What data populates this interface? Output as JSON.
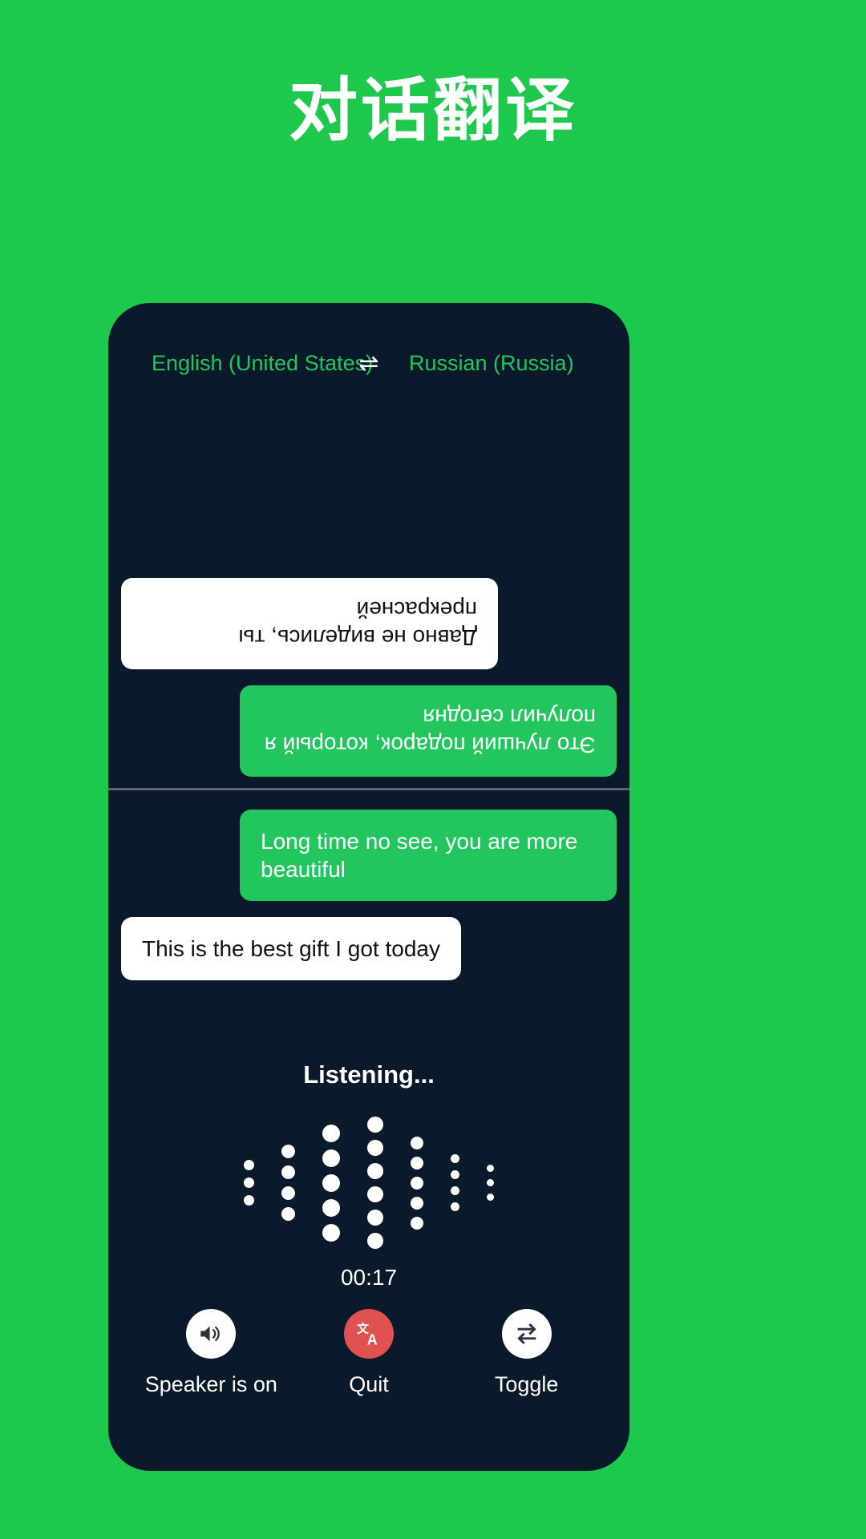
{
  "page": {
    "title": "对话翻译",
    "background_color": "#1DC84C"
  },
  "phone": {
    "background_color": "#0A1A2A",
    "accent_green": "#22C55E",
    "quit_red": "#E05252"
  },
  "language_bar": {
    "source_language": "English (United States)",
    "target_language": "Russian (Russia)",
    "swap_icon": "swap-horizontal-icon",
    "swap_glyph": "⇌"
  },
  "conversation": {
    "top_panel": {
      "rotated": "180",
      "messages": [
        {
          "text": "Это лучший подарок, который я получил сегодня",
          "style": "green",
          "align": "left"
        },
        {
          "text": "Давно не виделись, ты прекрасней",
          "style": "white",
          "align": "right"
        }
      ]
    },
    "bottom_panel": {
      "messages": [
        {
          "text": "Long time no see, you are more beautiful",
          "style": "green",
          "align": "right"
        },
        {
          "text": "This is the best gift I got today",
          "style": "white",
          "align": "left"
        }
      ]
    }
  },
  "status": {
    "listening_label": "Listening...",
    "timer": "00:17"
  },
  "waveform": {
    "columns": [
      {
        "count": 3,
        "size": 13
      },
      {
        "count": 4,
        "size": 17
      },
      {
        "count": 5,
        "size": 22
      },
      {
        "count": 6,
        "size": 20
      },
      {
        "count": 5,
        "size": 16
      },
      {
        "count": 4,
        "size": 11
      },
      {
        "count": 3,
        "size": 9
      }
    ]
  },
  "controls": [
    {
      "label": "Speaker is on",
      "icon": "speaker-on-icon",
      "style": "white"
    },
    {
      "label": "Quit",
      "icon": "translate-icon",
      "style": "red"
    },
    {
      "label": "Toggle",
      "icon": "repeat-swap-icon",
      "style": "white"
    }
  ]
}
